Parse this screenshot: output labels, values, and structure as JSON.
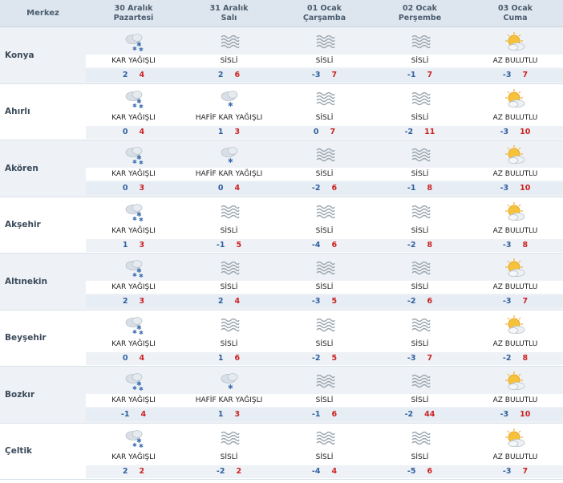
{
  "header": {
    "center_label": "Merkez",
    "days": [
      {
        "date": "30 Aralık",
        "weekday": "Pazartesi"
      },
      {
        "date": "31 Aralık",
        "weekday": "Salı"
      },
      {
        "date": "01 Ocak",
        "weekday": "Çarşamba"
      },
      {
        "date": "02 Ocak",
        "weekday": "Perşembe"
      },
      {
        "date": "03 Ocak",
        "weekday": "Cuma"
      }
    ]
  },
  "cities": [
    {
      "name": "Konya",
      "days": [
        {
          "icon": "snow-cloud-icon",
          "cond": "KAR YAĞIŞLI",
          "min": "2",
          "max": "4"
        },
        {
          "icon": "fog-icon",
          "cond": "SİSLİ",
          "min": "2",
          "max": "6"
        },
        {
          "icon": "fog-icon",
          "cond": "SİSLİ",
          "min": "-3",
          "max": "7"
        },
        {
          "icon": "fog-icon",
          "cond": "SİSLİ",
          "min": "-1",
          "max": "7"
        },
        {
          "icon": "sun-cloud-icon",
          "cond": "AZ BULUTLU",
          "min": "-3",
          "max": "7"
        }
      ]
    },
    {
      "name": "Ahırlı",
      "days": [
        {
          "icon": "snow-cloud-icon",
          "cond": "KAR YAĞIŞLI",
          "min": "0",
          "max": "4"
        },
        {
          "icon": "light-snow-icon",
          "cond": "HAFİF KAR YAĞIŞLI",
          "min": "1",
          "max": "3"
        },
        {
          "icon": "fog-icon",
          "cond": "SİSLİ",
          "min": "0",
          "max": "7"
        },
        {
          "icon": "fog-icon",
          "cond": "SİSLİ",
          "min": "-2",
          "max": "11"
        },
        {
          "icon": "sun-cloud-icon",
          "cond": "AZ BULUTLU",
          "min": "-3",
          "max": "10"
        }
      ]
    },
    {
      "name": "Akören",
      "days": [
        {
          "icon": "snow-cloud-icon",
          "cond": "KAR YAĞIŞLI",
          "min": "0",
          "max": "3"
        },
        {
          "icon": "light-snow-icon",
          "cond": "HAFİF KAR YAĞIŞLI",
          "min": "0",
          "max": "4"
        },
        {
          "icon": "fog-icon",
          "cond": "SİSLİ",
          "min": "-2",
          "max": "6"
        },
        {
          "icon": "fog-icon",
          "cond": "SİSLİ",
          "min": "-1",
          "max": "8"
        },
        {
          "icon": "sun-cloud-icon",
          "cond": "AZ BULUTLU",
          "min": "-3",
          "max": "10"
        }
      ]
    },
    {
      "name": "Akşehir",
      "days": [
        {
          "icon": "snow-cloud-icon",
          "cond": "KAR YAĞIŞLI",
          "min": "1",
          "max": "3"
        },
        {
          "icon": "fog-icon",
          "cond": "SİSLİ",
          "min": "-1",
          "max": "5"
        },
        {
          "icon": "fog-icon",
          "cond": "SİSLİ",
          "min": "-4",
          "max": "6"
        },
        {
          "icon": "fog-icon",
          "cond": "SİSLİ",
          "min": "-2",
          "max": "8"
        },
        {
          "icon": "sun-cloud-icon",
          "cond": "AZ BULUTLU",
          "min": "-3",
          "max": "8"
        }
      ]
    },
    {
      "name": "Altınekin",
      "days": [
        {
          "icon": "snow-cloud-icon",
          "cond": "KAR YAĞIŞLI",
          "min": "2",
          "max": "3"
        },
        {
          "icon": "fog-icon",
          "cond": "SİSLİ",
          "min": "2",
          "max": "4"
        },
        {
          "icon": "fog-icon",
          "cond": "SİSLİ",
          "min": "-3",
          "max": "5"
        },
        {
          "icon": "fog-icon",
          "cond": "SİSLİ",
          "min": "-2",
          "max": "6"
        },
        {
          "icon": "sun-cloud-icon",
          "cond": "AZ BULUTLU",
          "min": "-3",
          "max": "7"
        }
      ]
    },
    {
      "name": "Beyşehir",
      "days": [
        {
          "icon": "snow-cloud-icon",
          "cond": "KAR YAĞIŞLI",
          "min": "0",
          "max": "4"
        },
        {
          "icon": "fog-icon",
          "cond": "SİSLİ",
          "min": "1",
          "max": "6"
        },
        {
          "icon": "fog-icon",
          "cond": "SİSLİ",
          "min": "-2",
          "max": "5"
        },
        {
          "icon": "fog-icon",
          "cond": "SİSLİ",
          "min": "-3",
          "max": "7"
        },
        {
          "icon": "sun-cloud-icon",
          "cond": "AZ BULUTLU",
          "min": "-2",
          "max": "8"
        }
      ]
    },
    {
      "name": "Bozkır",
      "days": [
        {
          "icon": "snow-cloud-icon",
          "cond": "KAR YAĞIŞLI",
          "min": "-1",
          "max": "4"
        },
        {
          "icon": "light-snow-icon",
          "cond": "HAFİF KAR YAĞIŞLI",
          "min": "1",
          "max": "3"
        },
        {
          "icon": "fog-icon",
          "cond": "SİSLİ",
          "min": "-1",
          "max": "6"
        },
        {
          "icon": "fog-icon",
          "cond": "SİSLİ",
          "min": "-2",
          "max": "44"
        },
        {
          "icon": "sun-cloud-icon",
          "cond": "AZ BULUTLU",
          "min": "-3",
          "max": "10"
        }
      ]
    },
    {
      "name": "Çeltik",
      "days": [
        {
          "icon": "snow-cloud-icon",
          "cond": "KAR YAĞIŞLI",
          "min": "2",
          "max": "2"
        },
        {
          "icon": "fog-icon",
          "cond": "SİSLİ",
          "min": "-2",
          "max": "2"
        },
        {
          "icon": "fog-icon",
          "cond": "SİSLİ",
          "min": "-4",
          "max": "4"
        },
        {
          "icon": "fog-icon",
          "cond": "SİSLİ",
          "min": "-5",
          "max": "6"
        },
        {
          "icon": "sun-cloud-icon",
          "cond": "AZ BULUTLU",
          "min": "-3",
          "max": "7"
        }
      ]
    }
  ],
  "colors": {
    "header_bg": "#dde6ee",
    "min_temp": "#2f5f9e",
    "max_temp": "#cc2222",
    "sun": "#f2b12c"
  }
}
